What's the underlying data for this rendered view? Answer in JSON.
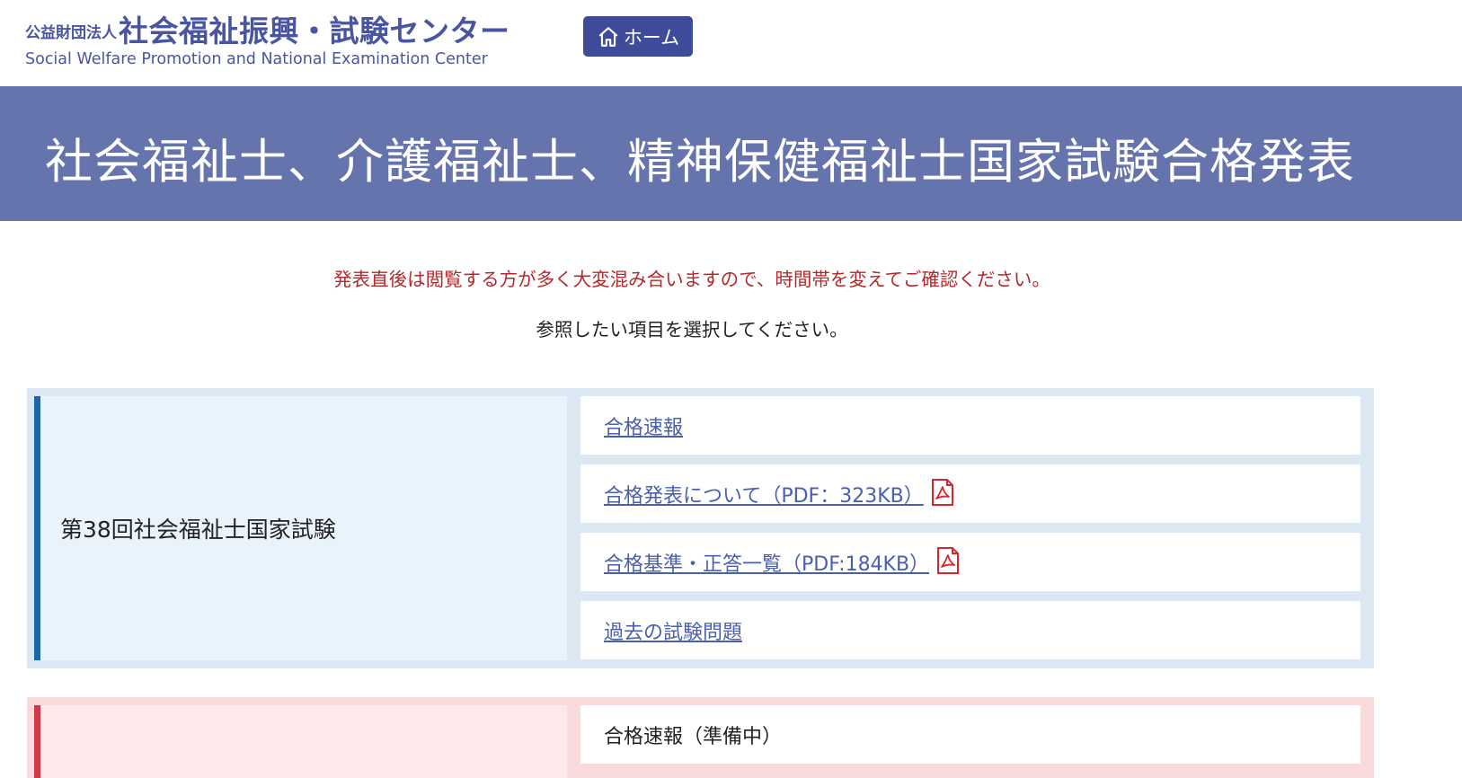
{
  "header": {
    "logo_prefix": "公益財団法人",
    "logo_name": "社会福祉振興・試験センター",
    "logo_sub": "Social Welfare Promotion and National Examination Center",
    "home_label": "ホーム"
  },
  "banner": {
    "title": "社会福祉士、介護福祉士、精神保健福祉士国家試験合格発表"
  },
  "notices": {
    "warning": "発表直後は閲覧する方が多く大変混み合いますので、時間帯を変えてご確認ください。",
    "instruction": "参照したい項目を選択してください。"
  },
  "exams": [
    {
      "title": "第38回社会福祉士国家試験",
      "accent_color": "#1c67a8",
      "links": [
        {
          "label": "合格速報",
          "pdf": false
        },
        {
          "label": "合格発表について（PDF：323KB）",
          "pdf": true
        },
        {
          "label": "合格基準・正答一覧（PDF:184KB）",
          "pdf": true
        },
        {
          "label": "過去の試験問題",
          "pdf": false
        }
      ]
    },
    {
      "title": "",
      "accent_color": "#cf3a46",
      "links": [
        {
          "label": "合格速報（準備中）",
          "pdf": false
        }
      ]
    }
  ],
  "colors": {
    "banner": "#6674ae",
    "brand": "#4a55a2",
    "warning_text": "#b5282c",
    "link": "#4a5fae",
    "pdf_icon": "#d9262e"
  },
  "icons": {
    "home": "home-icon",
    "pdf": "pdf-icon"
  }
}
